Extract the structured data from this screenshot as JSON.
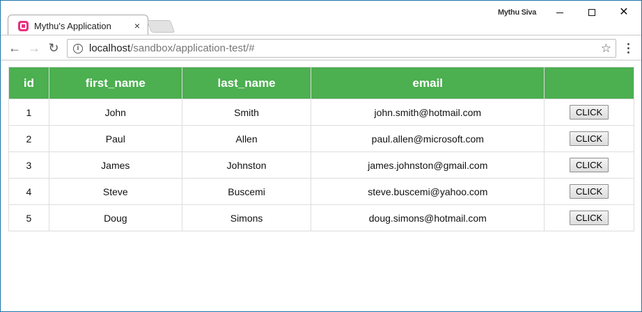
{
  "browser": {
    "tab_title": "Mythu's Application",
    "tab_close_glyph": "×",
    "user_name": "Mythu Siva",
    "url_host": "localhost",
    "url_path": "/sandbox/application-test/#",
    "icons": {
      "back": "arrow-left-icon",
      "forward": "arrow-right-icon",
      "reload": "reload-icon",
      "info": "info-icon",
      "star": "star-icon",
      "menu": "kebab-menu-icon"
    }
  },
  "table": {
    "headers": [
      "id",
      "first_name",
      "last_name",
      "email",
      ""
    ],
    "header_color": "#4caf50",
    "rows": [
      {
        "id": "1",
        "first_name": "John",
        "last_name": "Smith",
        "email": "john.smith@hotmail.com",
        "action": "CLICK"
      },
      {
        "id": "2",
        "first_name": "Paul",
        "last_name": "Allen",
        "email": "paul.allen@microsoft.com",
        "action": "CLICK"
      },
      {
        "id": "3",
        "first_name": "James",
        "last_name": "Johnston",
        "email": "james.johnston@gmail.com",
        "action": "CLICK"
      },
      {
        "id": "4",
        "first_name": "Steve",
        "last_name": "Buscemi",
        "email": "steve.buscemi@yahoo.com",
        "action": "CLICK"
      },
      {
        "id": "5",
        "first_name": "Doug",
        "last_name": "Simons",
        "email": "doug.simons@hotmail.com",
        "action": "CLICK"
      }
    ]
  }
}
